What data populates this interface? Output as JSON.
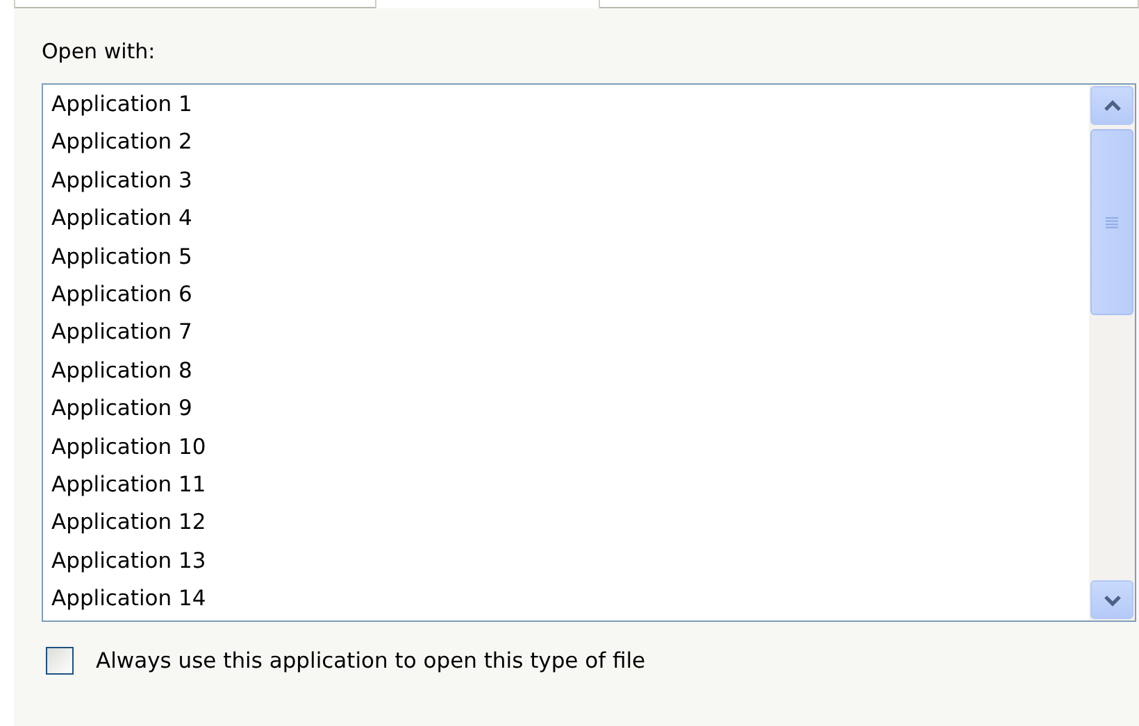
{
  "label": "Open with:",
  "applications": [
    {
      "name": "Application 1",
      "selected": false
    },
    {
      "name": "Application 2",
      "selected": false
    },
    {
      "name": "Application 3",
      "selected": false
    },
    {
      "name": "Application 4",
      "selected": false
    },
    {
      "name": "Application 5",
      "selected": false
    },
    {
      "name": "Application 6",
      "selected": false
    },
    {
      "name": "Application 7",
      "selected": false
    },
    {
      "name": "Application 8",
      "selected": false
    },
    {
      "name": "Application 9",
      "selected": false
    },
    {
      "name": "Application 10",
      "selected": false
    },
    {
      "name": "Application 11",
      "selected": false
    },
    {
      "name": "Application 12",
      "selected": false
    },
    {
      "name": "Application 13",
      "selected": false
    },
    {
      "name": "Application 14",
      "selected": false
    }
  ],
  "always_use": {
    "label": "Always use this application to open this type of file",
    "checked": false
  }
}
